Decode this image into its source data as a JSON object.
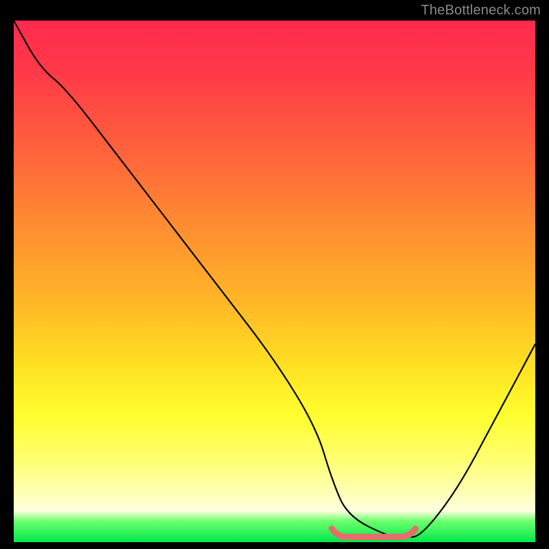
{
  "watermark": "TheBottleneck.com",
  "colors": {
    "background": "#000000",
    "curve": "#000000",
    "optimal_band": "#e86c6c",
    "gradient_top": "#ff2a4f",
    "gradient_bottom": "#00e84a"
  },
  "chart_data": {
    "type": "line",
    "title": "",
    "xlabel": "",
    "ylabel": "",
    "xlim": [
      0,
      100
    ],
    "ylim": [
      0,
      100
    ],
    "grid": false,
    "series": [
      {
        "name": "bottleneck-curve",
        "x": [
          0,
          5,
          10,
          20,
          30,
          40,
          50,
          58,
          61,
          64,
          72,
          75,
          78,
          85,
          92,
          100
        ],
        "y": [
          100,
          91,
          87,
          74,
          61,
          48,
          35,
          22,
          12,
          5,
          1,
          1,
          1,
          10,
          23,
          38
        ]
      }
    ],
    "annotations": [
      {
        "name": "optimal-range",
        "x_start": 61,
        "x_end": 77,
        "y": 1,
        "color": "#e86c6c"
      }
    ],
    "note": "Values estimated from pixel positions; y=0 is bottom (green), y=100 is top (red). Curve minimum (optimal) lies roughly between x≈61 and x≈77."
  }
}
